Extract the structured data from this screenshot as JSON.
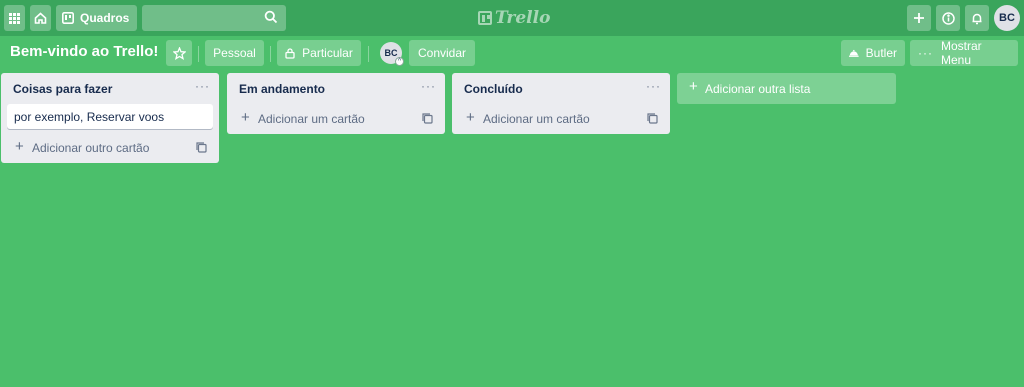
{
  "topbar": {
    "boards_label": "Quadros",
    "search_value": "",
    "logo_text": "Trello",
    "user_initials": "BC"
  },
  "board": {
    "title": "Bem-vindo ao Trello!",
    "team_label": "Pessoal",
    "visibility_label": "Particular",
    "member_initials": "BC",
    "invite_label": "Convidar",
    "butler_label": "Butler",
    "menu_label": "Mostrar Menu"
  },
  "lists": [
    {
      "title": "Coisas para fazer",
      "more": "···",
      "cards": [
        "por exemplo, Reservar voos"
      ],
      "add_label": "Adicionar outro cartão"
    },
    {
      "title": "Em andamento",
      "more": "···",
      "cards": [],
      "add_label": "Adicionar um cartão"
    },
    {
      "title": "Concluído",
      "more": "···",
      "cards": [],
      "add_label": "Adicionar um cartão"
    }
  ],
  "add_list_label": "Adicionar outra lista",
  "colors": {
    "board_background": "#4bbf6b",
    "header_background": "#3aa55c",
    "list_background": "#ebecf0"
  }
}
